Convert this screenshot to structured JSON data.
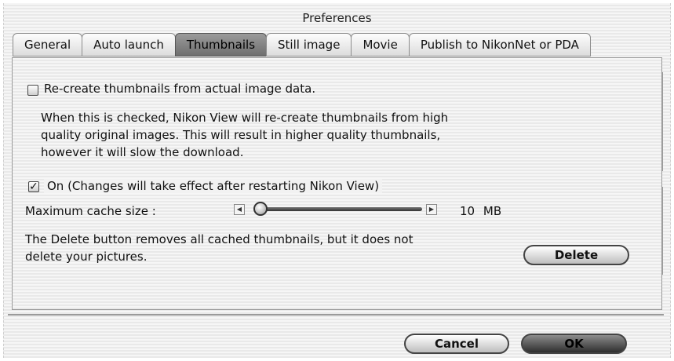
{
  "window": {
    "title": "Preferences"
  },
  "tabs": [
    {
      "label": "General",
      "active": false
    },
    {
      "label": "Auto launch",
      "active": false
    },
    {
      "label": "Thumbnails",
      "active": true
    },
    {
      "label": "Still image",
      "active": false
    },
    {
      "label": "Movie",
      "active": false
    },
    {
      "label": "Publish to NikonNet or PDA",
      "active": false
    }
  ],
  "recreate": {
    "checkbox_label": "Re-create thumbnails from actual image data.",
    "checked": false,
    "description_lines": [
      "When this is checked, Nikon View will re-create thumbnails from high",
      "quality original images. This will result in higher quality thumbnails,",
      "however it will slow the download."
    ]
  },
  "cache": {
    "checkbox_label": "On (Changes will take effect after restarting Nikon View)",
    "checked": true,
    "size_label": "Maximum cache size :",
    "size_value": "10",
    "size_unit": "MB",
    "slider_fraction": 0.0,
    "note_lines": [
      "The Delete button removes all cached thumbnails, but it does not",
      "delete your pictures."
    ],
    "delete_label": "Delete"
  },
  "footer": {
    "cancel_label": "Cancel",
    "ok_label": "OK"
  }
}
